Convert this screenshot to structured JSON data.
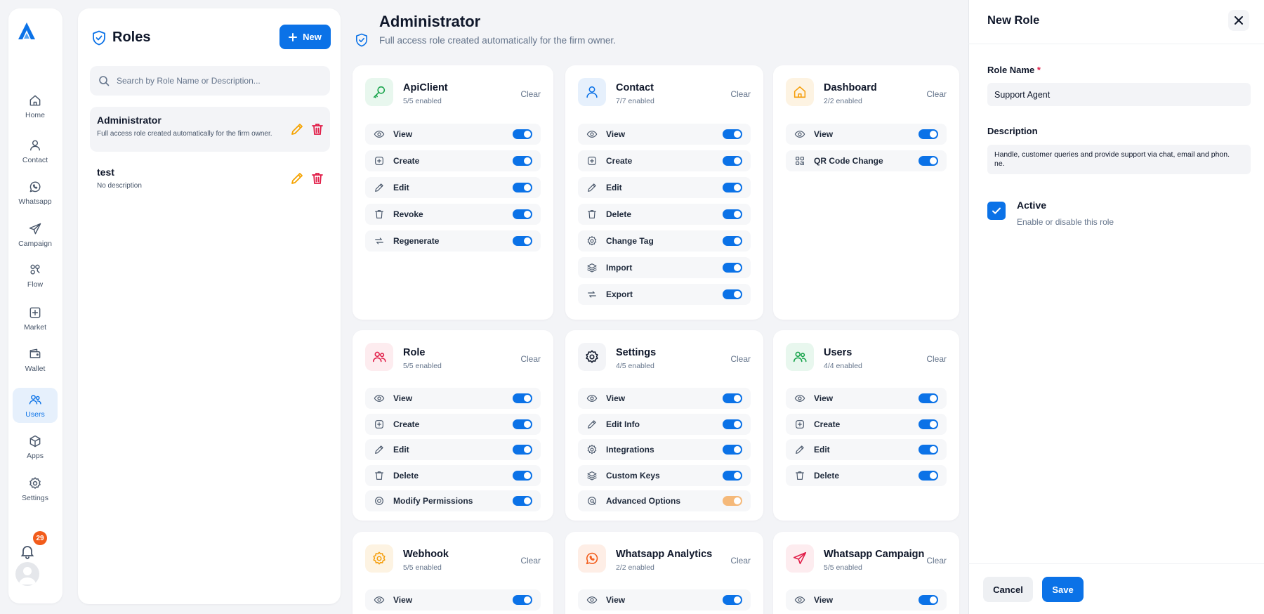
{
  "nav": {
    "items": [
      {
        "label": "Home",
        "icon": "home-icon"
      },
      {
        "label": "Contact",
        "icon": "contact-icon"
      },
      {
        "label": "Whatsapp",
        "icon": "whatsapp-icon"
      },
      {
        "label": "Campaign",
        "icon": "send-icon"
      },
      {
        "label": "Flow",
        "icon": "flow-icon"
      },
      {
        "label": "Market",
        "icon": "market-icon"
      },
      {
        "label": "Wallet",
        "icon": "wallet-icon"
      },
      {
        "label": "Users",
        "icon": "users-icon",
        "active": true
      },
      {
        "label": "Apps",
        "icon": "apps-icon"
      },
      {
        "label": "Settings",
        "icon": "settings-icon"
      }
    ],
    "notifications_count": "29"
  },
  "roles_panel": {
    "title": "Roles",
    "new_label": "New",
    "search_placeholder": "Search by Role Name or Description...",
    "roles": [
      {
        "name": "Administrator",
        "description": "Full access role created automatically for the firm owner."
      },
      {
        "name": "test",
        "description": "No description"
      }
    ]
  },
  "main": {
    "title": "Administrator",
    "subtitle": "Full access role created automatically for the firm owner.",
    "clear_label": "Clear",
    "modules": [
      {
        "name": "ApiClient",
        "count": "5/5 enabled",
        "icon": "key-icon",
        "color": "#16a34a",
        "bg": "#e8f7ee",
        "perms": [
          {
            "label": "View",
            "icon": "eye-icon"
          },
          {
            "label": "Create",
            "icon": "plus-square-icon"
          },
          {
            "label": "Edit",
            "icon": "pencil-icon"
          },
          {
            "label": "Revoke",
            "icon": "trash-icon"
          },
          {
            "label": "Regenerate",
            "icon": "refresh-icon"
          }
        ]
      },
      {
        "name": "Contact",
        "count": "7/7 enabled",
        "icon": "contact-icon",
        "color": "#0b72e7",
        "bg": "#e6f0fc",
        "perms": [
          {
            "label": "View",
            "icon": "eye-icon"
          },
          {
            "label": "Create",
            "icon": "plus-square-icon"
          },
          {
            "label": "Edit",
            "icon": "pencil-icon"
          },
          {
            "label": "Delete",
            "icon": "trash-icon"
          },
          {
            "label": "Change Tag",
            "icon": "gear-icon"
          },
          {
            "label": "Import",
            "icon": "layers-icon"
          },
          {
            "label": "Export",
            "icon": "refresh-icon"
          }
        ]
      },
      {
        "name": "Dashboard",
        "count": "2/2 enabled",
        "icon": "home-icon",
        "color": "#f59e0b",
        "bg": "#fdf3e2",
        "perms": [
          {
            "label": "View",
            "icon": "eye-icon"
          },
          {
            "label": "QR Code Change",
            "icon": "qr-icon"
          }
        ]
      },
      {
        "name": "Role",
        "count": "5/5 enabled",
        "icon": "users-icon",
        "color": "#e11d48",
        "bg": "#fdecef",
        "perms": [
          {
            "label": "View",
            "icon": "eye-icon"
          },
          {
            "label": "Create",
            "icon": "plus-square-icon"
          },
          {
            "label": "Edit",
            "icon": "pencil-icon"
          },
          {
            "label": "Delete",
            "icon": "trash-icon"
          },
          {
            "label": "Modify Permissions",
            "icon": "target-icon"
          }
        ]
      },
      {
        "name": "Settings",
        "count": "4/5 enabled",
        "icon": "settings-icon",
        "color": "#0f172a",
        "bg": "#f3f4f7",
        "perms": [
          {
            "label": "View",
            "icon": "eye-icon"
          },
          {
            "label": "Edit Info",
            "icon": "pencil-icon"
          },
          {
            "label": "Integrations",
            "icon": "gear-icon"
          },
          {
            "label": "Custom Keys",
            "icon": "layers-icon"
          },
          {
            "label": "Advanced Options",
            "icon": "sliders-icon",
            "off": true
          }
        ]
      },
      {
        "name": "Users",
        "count": "4/4 enabled",
        "icon": "users-icon",
        "color": "#16a34a",
        "bg": "#e8f7ee",
        "perms": [
          {
            "label": "View",
            "icon": "eye-icon"
          },
          {
            "label": "Create",
            "icon": "plus-square-icon"
          },
          {
            "label": "Edit",
            "icon": "pencil-icon"
          },
          {
            "label": "Delete",
            "icon": "trash-icon"
          }
        ]
      },
      {
        "name": "Webhook",
        "count": "5/5 enabled",
        "icon": "gear-icon",
        "color": "#f59e0b",
        "bg": "#fdf3e2",
        "perms": [
          {
            "label": "View",
            "icon": "eye-icon"
          }
        ]
      },
      {
        "name": "Whatsapp Analytics",
        "count": "2/2 enabled",
        "icon": "whatsapp-icon",
        "color": "#f25c1b",
        "bg": "#feeee6",
        "perms": [
          {
            "label": "View",
            "icon": "eye-icon"
          }
        ]
      },
      {
        "name": "Whatsapp Campaign",
        "count": "5/5 enabled",
        "icon": "send-icon",
        "color": "#e11d48",
        "bg": "#fdecef",
        "perms": [
          {
            "label": "View",
            "icon": "eye-icon"
          }
        ]
      }
    ]
  },
  "drawer": {
    "title": "New Role",
    "role_name_label": "Role Name",
    "required_mark": "*",
    "role_name_value": "Support Agent",
    "description_label": "Description",
    "description_value": "Handle, customer queries and provide support via chat, email and phon.\nne.",
    "active_label": "Active",
    "active_sub": "Enable or disable this role",
    "cancel_label": "Cancel",
    "save_label": "Save"
  },
  "colors": {
    "accent": "#0b72e7",
    "danger": "#e11d48",
    "warning": "#f5a300",
    "badge": "#f25c1b"
  }
}
